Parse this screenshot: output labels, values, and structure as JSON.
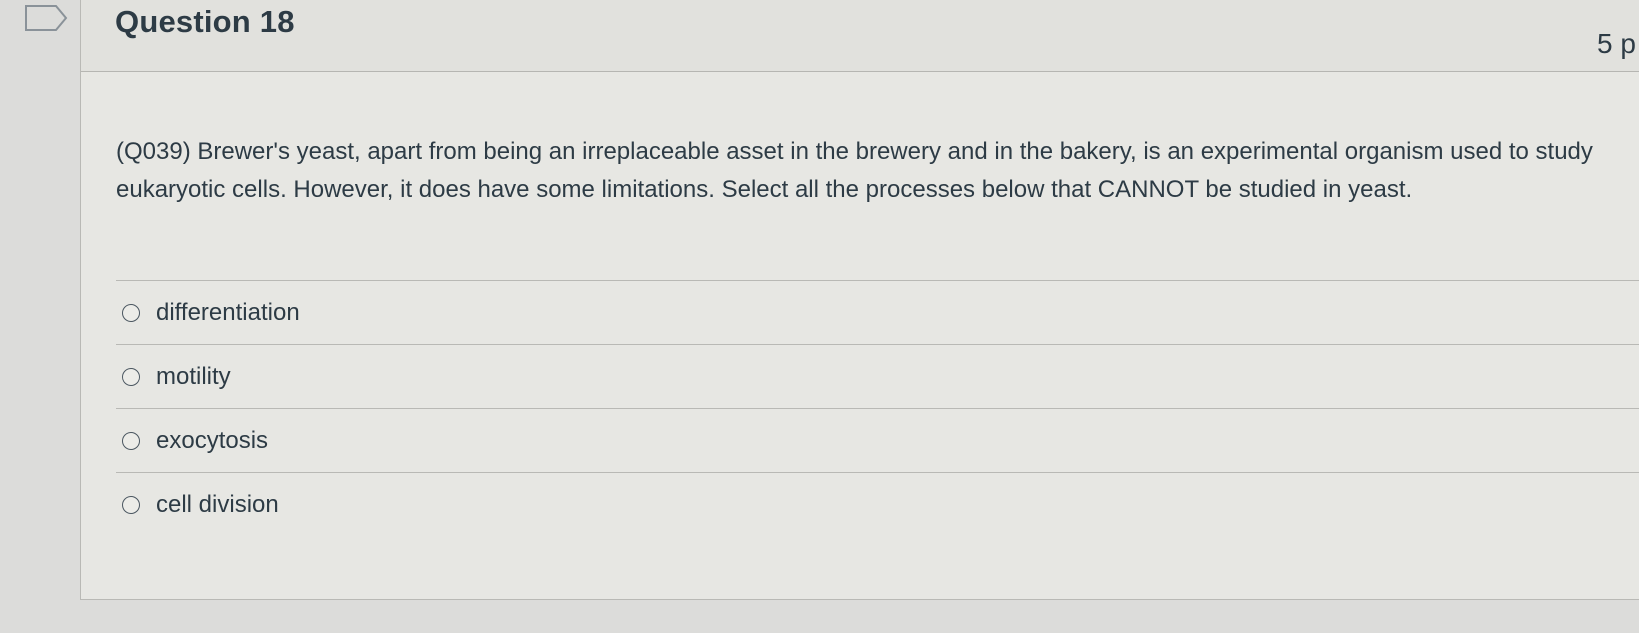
{
  "question": {
    "title": "Question 18",
    "points": "5 p",
    "text": "(Q039) Brewer's yeast, apart from being an irreplaceable asset in the brewery and in the bakery, is an experimental organism used to study eukaryotic cells. However, it does have some limitations. Select all the processes below that CANNOT be studied in yeast.",
    "answers": [
      {
        "label": "differentiation"
      },
      {
        "label": "motility"
      },
      {
        "label": "exocytosis"
      },
      {
        "label": "cell division"
      }
    ]
  },
  "colors": {
    "text": "#2d3b45",
    "background": "#e7e7e3",
    "border": "#b9b9b5"
  }
}
